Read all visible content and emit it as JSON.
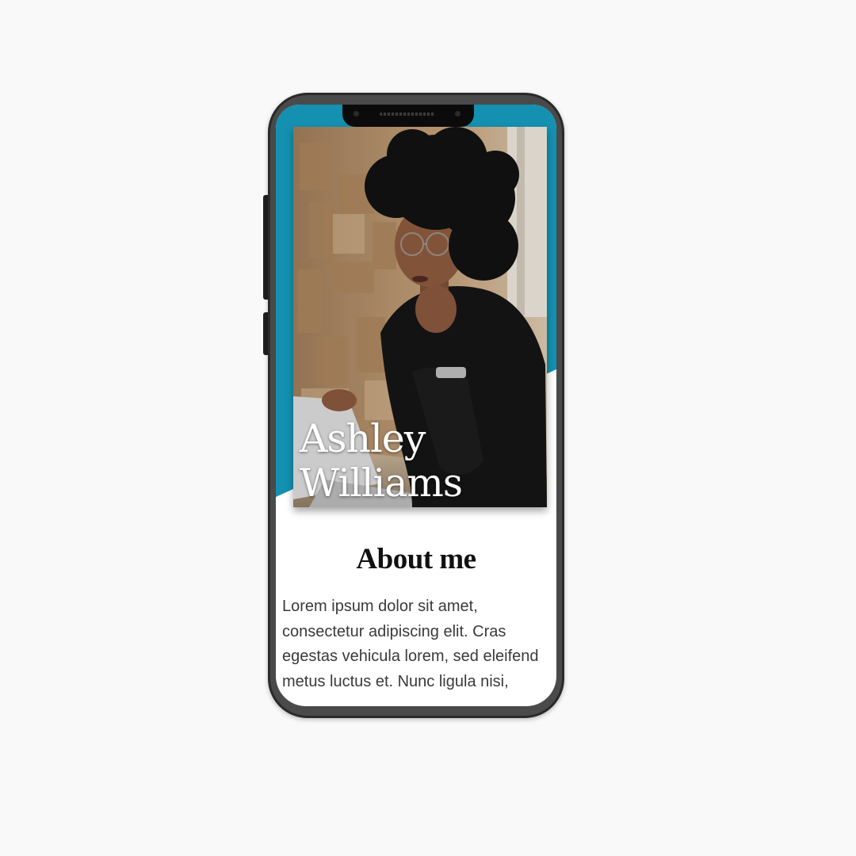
{
  "profile": {
    "first_name": "Ashley",
    "last_name": "Williams",
    "photo_alt": "woman-working-on-laptop"
  },
  "about": {
    "title": "About me",
    "body": "Lorem ipsum dolor sit amet, consectetur adipiscing elit. Cras egestas vehicula lorem, sed eleifend metus luctus et. Nunc ligula nisi,"
  },
  "colors": {
    "accent": "#1491b1",
    "frame": "#4a4a4a",
    "background": "#f9f9f9"
  }
}
